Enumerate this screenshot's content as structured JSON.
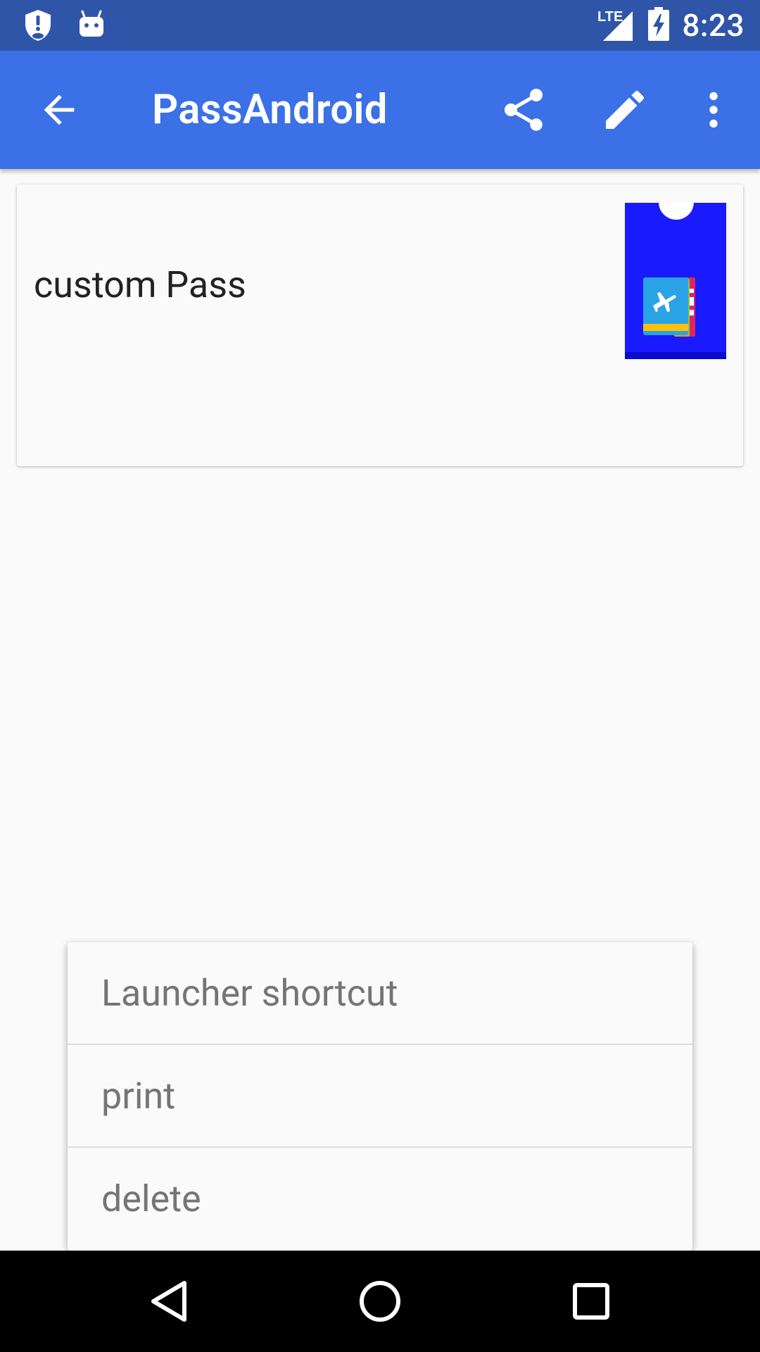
{
  "status_bar": {
    "time": "8:23",
    "network": "LTE",
    "left_icons": [
      "shield-alert-icon",
      "android-debug-icon"
    ],
    "right_icons": [
      "lte-signal-icon",
      "battery-charging-icon"
    ]
  },
  "app_bar": {
    "title": "PassAndroid",
    "actions": [
      "share-icon",
      "edit-icon",
      "more-vert-icon"
    ],
    "background": "#3b70e6"
  },
  "pass_card": {
    "title": "custom Pass",
    "thumbnail_icon": "boarding-pass-icon",
    "thumbnail_color": "#1a1aff"
  },
  "overflow_menu": {
    "items": [
      {
        "label": "Launcher shortcut"
      },
      {
        "label": "print"
      },
      {
        "label": "delete"
      }
    ]
  },
  "nav_bar": {
    "buttons": [
      "back-triangle-icon",
      "home-circle-icon",
      "recents-square-icon"
    ]
  }
}
